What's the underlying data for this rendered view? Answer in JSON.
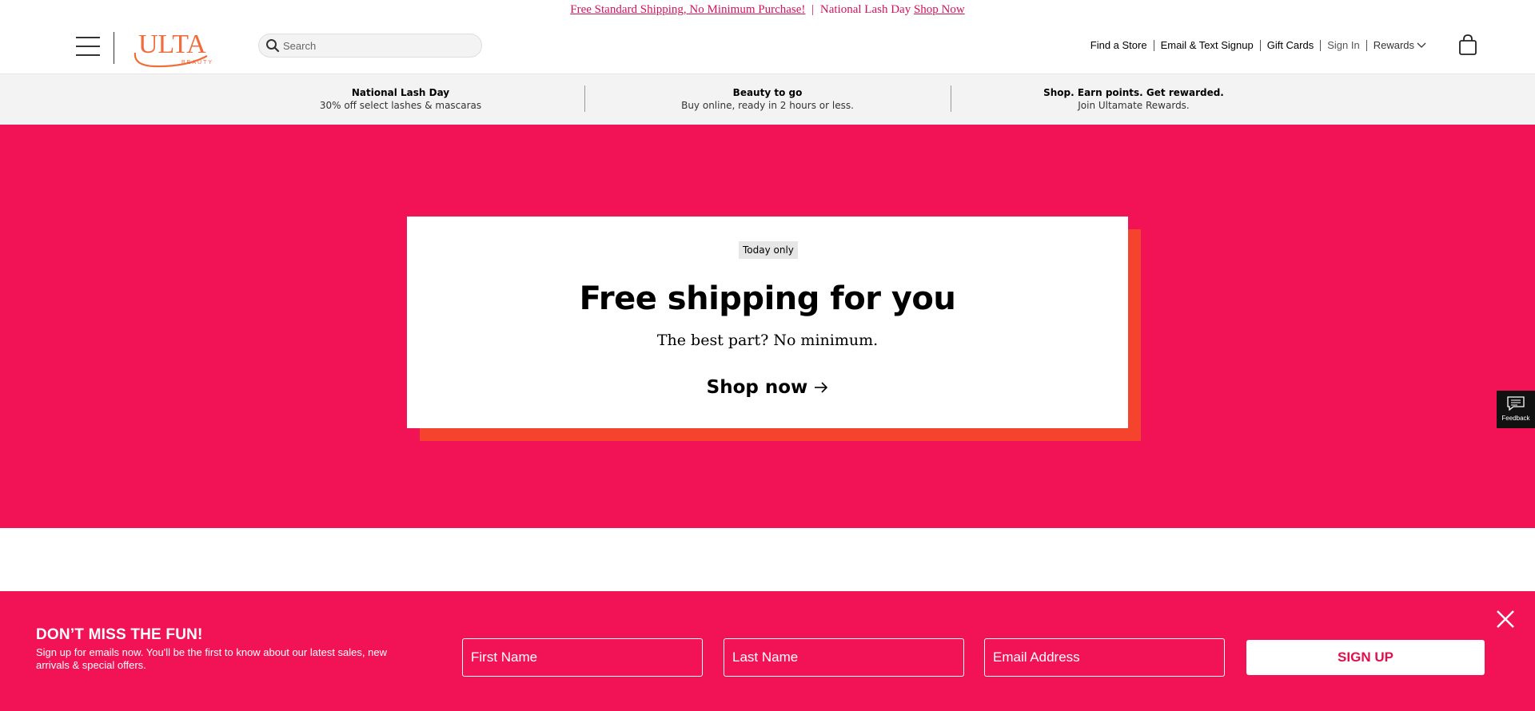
{
  "promo_bar": {
    "shipping_link": "Free Standard Shipping, No Minimum Purchase!",
    "separator": "|",
    "event_text": "National Lash Day",
    "shop_link": "Shop Now"
  },
  "header": {
    "logo_text": "ULTA",
    "logo_sub": "BEAUTY",
    "search_placeholder": "Search",
    "nav": {
      "find_store": "Find a Store",
      "email_signup": "Email & Text Signup",
      "gift_cards": "Gift Cards",
      "sign_in": "Sign In",
      "rewards": "Rewards"
    }
  },
  "value_props": [
    {
      "title": "National Lash Day",
      "subtitle": "30% off select lashes & mascaras"
    },
    {
      "title": "Beauty to go",
      "subtitle": "Buy online, ready in 2 hours or less."
    },
    {
      "title": "Shop. Earn points. Get rewarded.",
      "subtitle": "Join Ultamate Rewards."
    }
  ],
  "hero": {
    "badge": "Today only",
    "title": "Free shipping for you",
    "subtitle": "The best part? No minimum.",
    "cta": "Shop now"
  },
  "feedback": {
    "label": "Feedback"
  },
  "signup": {
    "heading": "DON’T MISS THE FUN!",
    "description": "Sign up for emails now. You'll be the first to know about our latest sales, new arrivals & special offers.",
    "first_name_placeholder": "First Name",
    "last_name_placeholder": "Last Name",
    "email_placeholder": "Email Address",
    "button": "SIGN UP"
  },
  "colors": {
    "brand_pink": "#f11356",
    "accent_orange": "#f4442d",
    "logo_orange": "#f26b3a"
  }
}
